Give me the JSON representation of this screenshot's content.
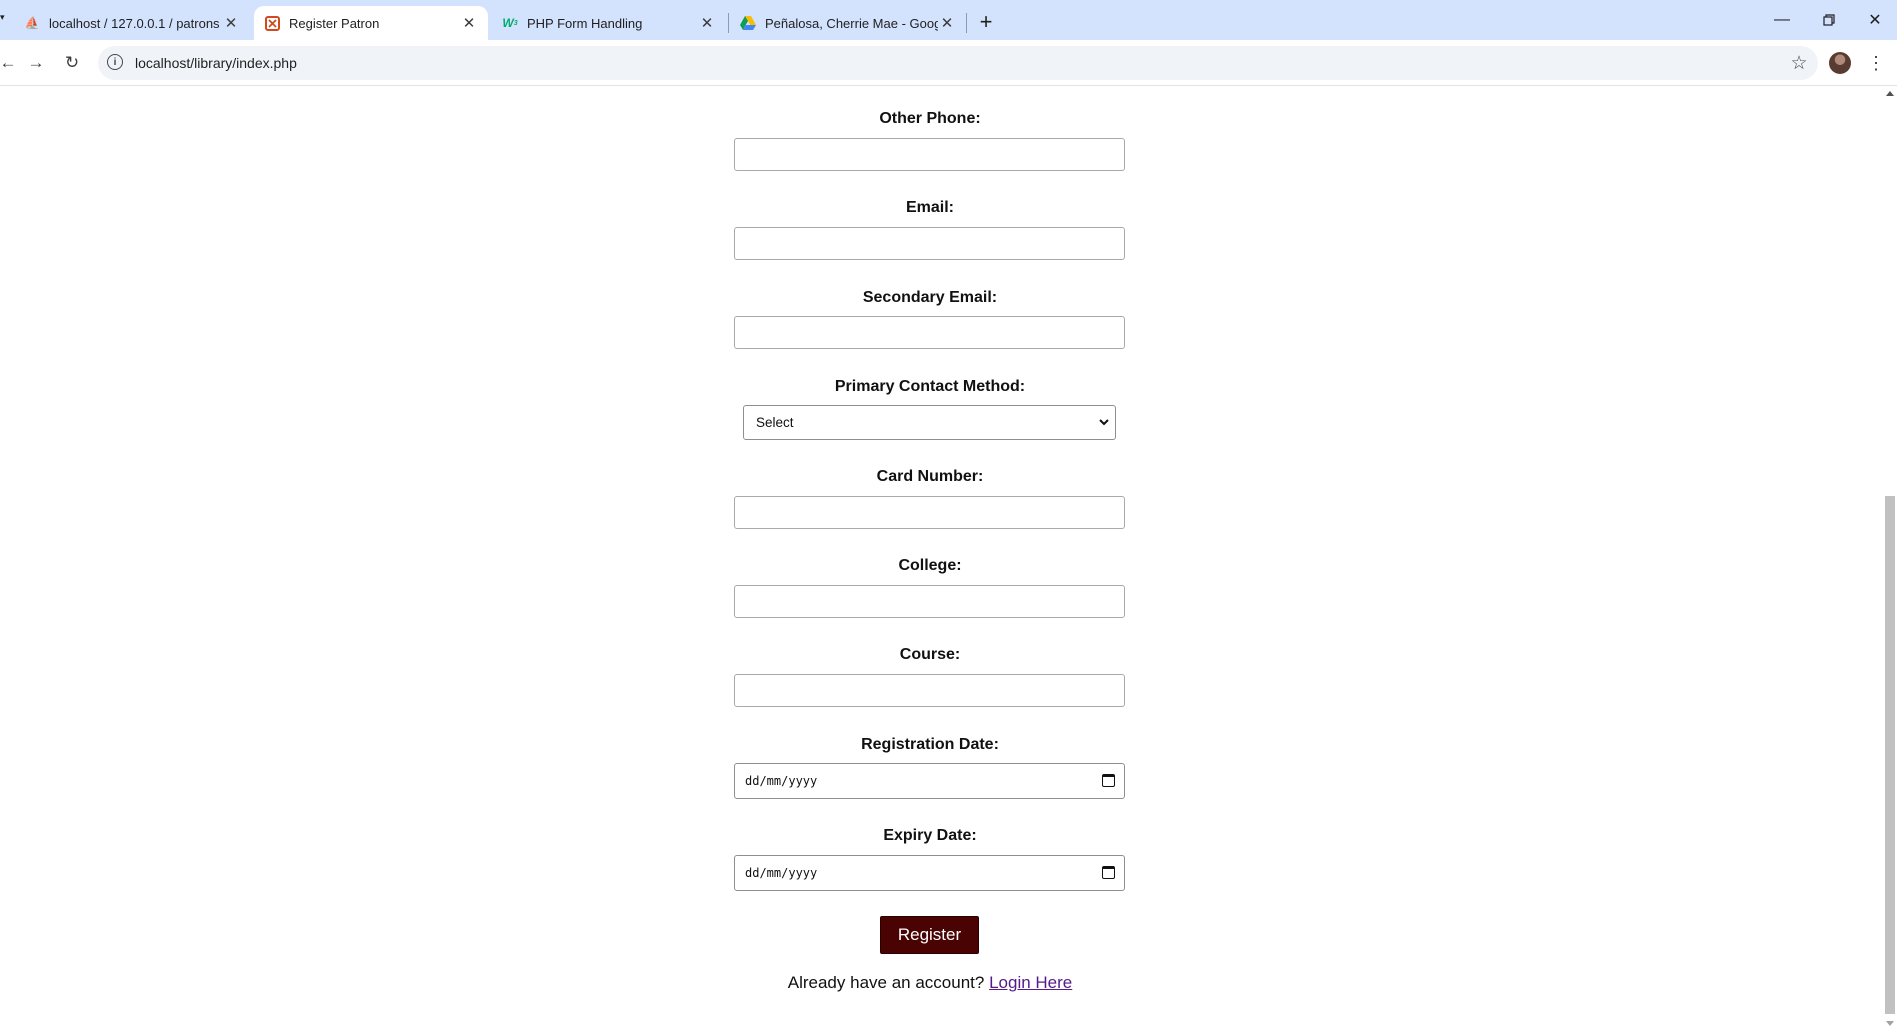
{
  "browser": {
    "tabs": [
      {
        "title": "localhost / 127.0.0.1 / patrons |",
        "icon": "phpmyadmin-icon"
      },
      {
        "title": "Register Patron",
        "icon": "page-icon"
      },
      {
        "title": "PHP Form Handling",
        "icon": "w3schools-icon"
      },
      {
        "title": "Peñalosa, Cherrie Mae - Google",
        "icon": "google-drive-icon"
      }
    ],
    "url": "localhost/library/index.php"
  },
  "form": {
    "other_phone_label": "Other Phone:",
    "email_label": "Email:",
    "secondary_email_label": "Secondary Email:",
    "contact_method_label": "Primary Contact Method:",
    "contact_method_value": "Select",
    "card_number_label": "Card Number:",
    "college_label": "College:",
    "course_label": "Course:",
    "registration_date_label": "Registration Date:",
    "registration_date_placeholder": "dd/mm/yyyy",
    "expiry_date_label": "Expiry Date:",
    "expiry_date_placeholder": "dd/mm/yyyy",
    "register_button": "Register",
    "login_prompt": "Already have an account?",
    "login_link": "Login Here"
  },
  "colors": {
    "register_button_bg": "#4a0303",
    "link_visited": "#551a8b",
    "tabstrip_bg": "#d3e3fd"
  }
}
